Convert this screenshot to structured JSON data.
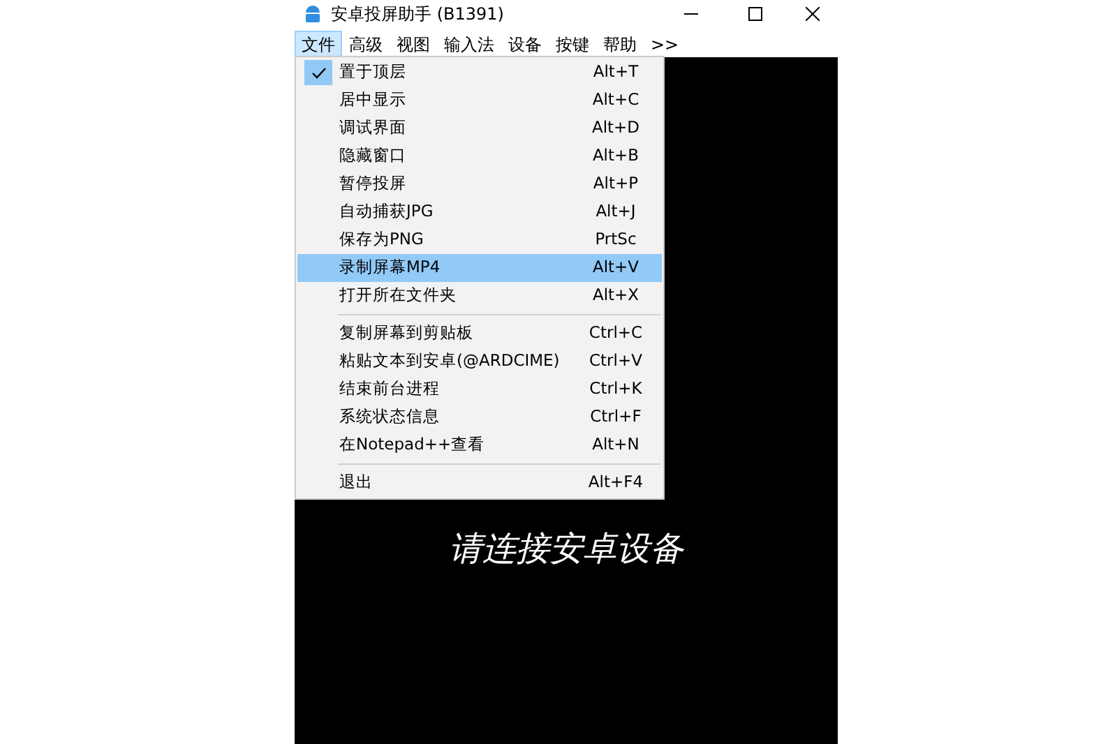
{
  "window": {
    "title": "安卓投屏助手 (B1391)"
  },
  "menubar": [
    {
      "label": "文件",
      "selected": true
    },
    {
      "label": "高级",
      "selected": false
    },
    {
      "label": "视图",
      "selected": false
    },
    {
      "label": "输入法",
      "selected": false
    },
    {
      "label": "设备",
      "selected": false
    },
    {
      "label": "按键",
      "selected": false
    },
    {
      "label": "帮助",
      "selected": false
    },
    {
      "label": ">>",
      "selected": false
    }
  ],
  "menu": [
    {
      "kind": "item",
      "label": "置于顶层",
      "shortcut": "Alt+T",
      "checked": true,
      "selected": false
    },
    {
      "kind": "item",
      "label": "居中显示",
      "shortcut": "Alt+C",
      "checked": false,
      "selected": false
    },
    {
      "kind": "item",
      "label": "调试界面",
      "shortcut": "Alt+D",
      "checked": false,
      "selected": false
    },
    {
      "kind": "item",
      "label": "隐藏窗口",
      "shortcut": "Alt+B",
      "checked": false,
      "selected": false
    },
    {
      "kind": "item",
      "label": "暂停投屏",
      "shortcut": "Alt+P",
      "checked": false,
      "selected": false
    },
    {
      "kind": "item",
      "label": "自动捕获JPG",
      "shortcut": "Alt+J",
      "checked": false,
      "selected": false
    },
    {
      "kind": "item",
      "label": "保存为PNG",
      "shortcut": "PrtSc",
      "checked": false,
      "selected": false
    },
    {
      "kind": "item",
      "label": "录制屏幕MP4",
      "shortcut": "Alt+V",
      "checked": false,
      "selected": true
    },
    {
      "kind": "item",
      "label": "打开所在文件夹",
      "shortcut": "Alt+X",
      "checked": false,
      "selected": false
    },
    {
      "kind": "separator"
    },
    {
      "kind": "item",
      "label": "复制屏幕到剪贴板",
      "shortcut": "Ctrl+C",
      "checked": false,
      "selected": false
    },
    {
      "kind": "item",
      "label": "粘贴文本到安卓(@ARDCIME)",
      "shortcut": "Ctrl+V",
      "checked": false,
      "selected": false
    },
    {
      "kind": "item",
      "label": "结束前台进程",
      "shortcut": "Ctrl+K",
      "checked": false,
      "selected": false
    },
    {
      "kind": "item",
      "label": "系统状态信息",
      "shortcut": "Ctrl+F",
      "checked": false,
      "selected": false
    },
    {
      "kind": "item",
      "label": "在Notepad++查看",
      "shortcut": "Alt+N",
      "checked": false,
      "selected": false
    },
    {
      "kind": "separator"
    },
    {
      "kind": "item",
      "label": "退出",
      "shortcut": "Alt+F4",
      "checked": false,
      "selected": false
    }
  ],
  "screen": {
    "message": "请连接安卓设备"
  }
}
